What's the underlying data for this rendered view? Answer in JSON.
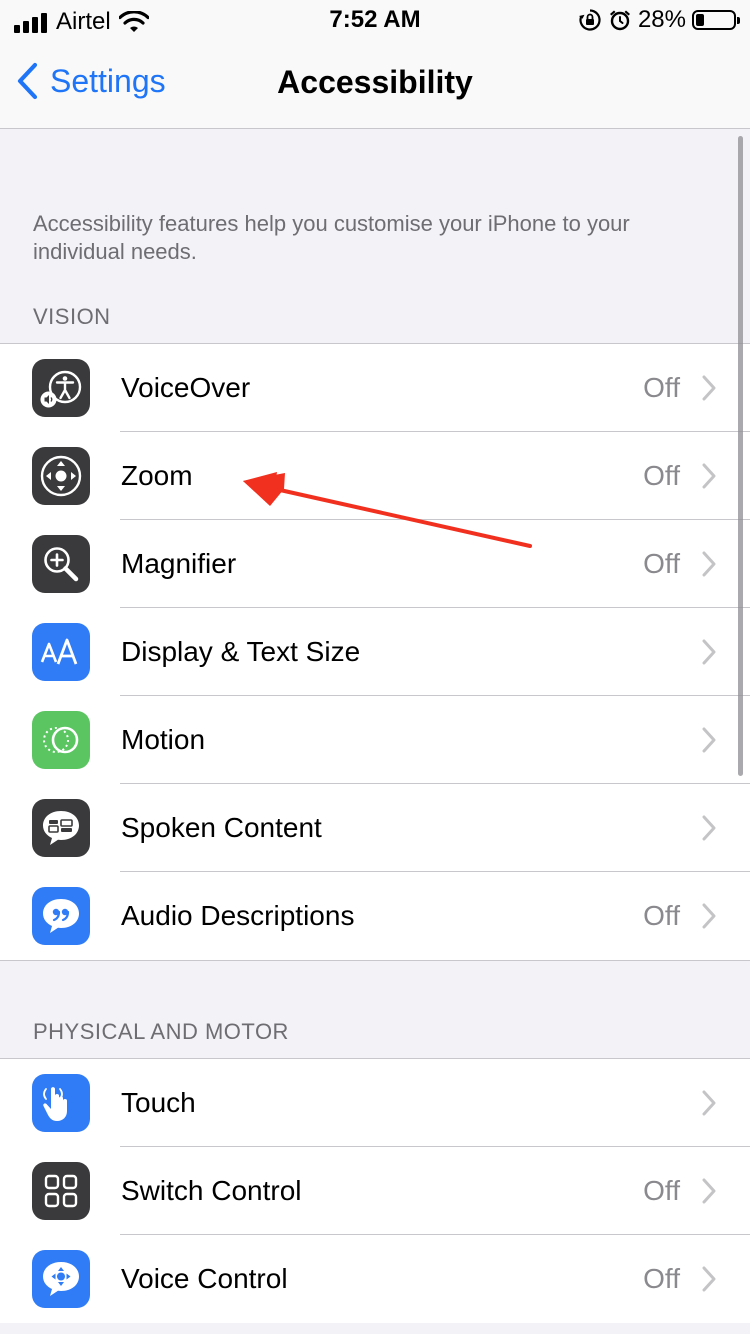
{
  "status_bar": {
    "carrier": "Airtel",
    "time": "7:52 AM",
    "battery": "28%",
    "battery_level": 0.28,
    "icons": [
      "signal-icon",
      "wifi-icon",
      "rotation-lock-icon",
      "alarm-icon",
      "battery-icon"
    ]
  },
  "nav": {
    "back_label": "Settings",
    "title": "Accessibility"
  },
  "intro": "Accessibility features help you customise your iPhone to your individual needs.",
  "sections": {
    "vision": {
      "header": "VISION",
      "items": [
        {
          "label": "VoiceOver",
          "value": "Off",
          "icon": "voiceover-icon",
          "color": "#3a3a3c"
        },
        {
          "label": "Zoom",
          "value": "Off",
          "icon": "zoom-icon",
          "color": "#3a3a3c"
        },
        {
          "label": "Magnifier",
          "value": "Off",
          "icon": "magnifier-icon",
          "color": "#3a3a3c"
        },
        {
          "label": "Display & Text Size",
          "value": "",
          "icon": "text-size-icon",
          "color": "#2f7cf6"
        },
        {
          "label": "Motion",
          "value": "",
          "icon": "motion-icon",
          "color": "#5ac561"
        },
        {
          "label": "Spoken Content",
          "value": "",
          "icon": "spoken-content-icon",
          "color": "#3a3a3c"
        },
        {
          "label": "Audio Descriptions",
          "value": "Off",
          "icon": "audio-descriptions-icon",
          "color": "#2f7cf6"
        }
      ]
    },
    "physical": {
      "header": "PHYSICAL AND MOTOR",
      "items": [
        {
          "label": "Touch",
          "value": "",
          "icon": "touch-icon",
          "color": "#2f7cf6"
        },
        {
          "label": "Switch Control",
          "value": "Off",
          "icon": "switch-control-icon",
          "color": "#3a3a3c"
        },
        {
          "label": "Voice Control",
          "value": "Off",
          "icon": "voice-control-icon",
          "color": "#2f7cf6"
        }
      ]
    }
  },
  "colors": {
    "accent": "#1f75f7",
    "annotation_arrow": "#f2301f"
  }
}
